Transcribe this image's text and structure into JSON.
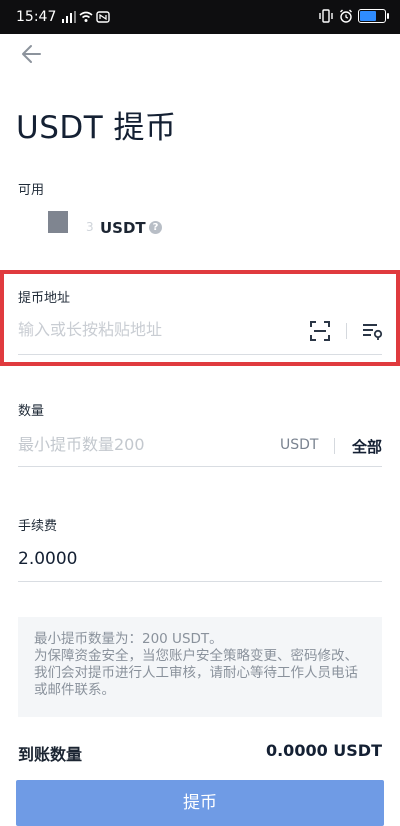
{
  "status_bar": {
    "time": "15:47",
    "battery_percent": 65,
    "icons": [
      "notification-icon",
      "signal-icon",
      "wifi-icon",
      "nfc-icon",
      "vibrate-icon",
      "alarm-icon",
      "battery-icon"
    ]
  },
  "header": {
    "title": "USDT 提币"
  },
  "available": {
    "label": "可用",
    "amount": "3",
    "unit": "USDT",
    "help_icon": "?"
  },
  "address": {
    "label": "提币地址",
    "placeholder": "输入或长按粘贴地址",
    "highlight_color": "#e03a3e"
  },
  "amount": {
    "label": "数量",
    "placeholder": "最小提币数量200",
    "unit": "USDT",
    "all_label": "全部"
  },
  "fee": {
    "label": "手续费",
    "value": "2.0000"
  },
  "notice": {
    "lines": [
      "最小提币数量为：200 USDT。",
      "为保障资金安全，当您账户安全策略变更、密码修改、我们会对提币进行人工审核，请耐心等待工作人员电话或邮件联系。"
    ]
  },
  "receive": {
    "label": "到账数量",
    "value": "0.0000 USDT"
  },
  "submit": {
    "label": "提币",
    "color": "#6f9be5"
  }
}
